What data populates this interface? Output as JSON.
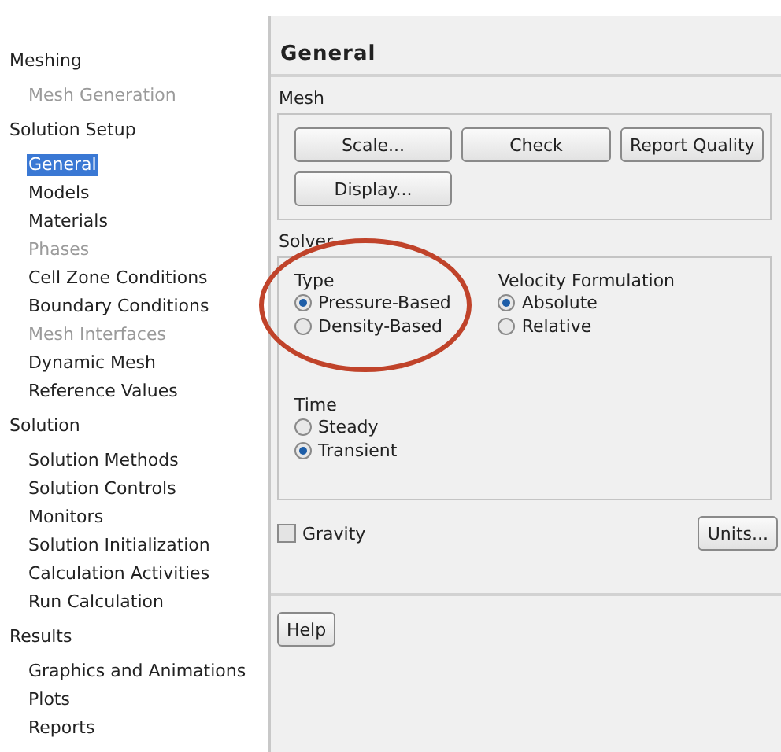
{
  "tree": [
    {
      "label": "Meshing",
      "children": [
        {
          "label": "Mesh Generation",
          "selected": false,
          "disabled": true
        }
      ]
    },
    {
      "label": "Solution Setup",
      "children": [
        {
          "label": "General",
          "selected": true,
          "disabled": false
        },
        {
          "label": "Models",
          "selected": false,
          "disabled": false
        },
        {
          "label": "Materials",
          "selected": false,
          "disabled": false
        },
        {
          "label": "Phases",
          "selected": false,
          "disabled": true
        },
        {
          "label": "Cell Zone Conditions",
          "selected": false,
          "disabled": false
        },
        {
          "label": "Boundary Conditions",
          "selected": false,
          "disabled": false
        },
        {
          "label": "Mesh Interfaces",
          "selected": false,
          "disabled": true
        },
        {
          "label": "Dynamic Mesh",
          "selected": false,
          "disabled": false
        },
        {
          "label": "Reference Values",
          "selected": false,
          "disabled": false
        }
      ]
    },
    {
      "label": "Solution",
      "children": [
        {
          "label": "Solution Methods",
          "selected": false,
          "disabled": false
        },
        {
          "label": "Solution Controls",
          "selected": false,
          "disabled": false
        },
        {
          "label": "Monitors",
          "selected": false,
          "disabled": false
        },
        {
          "label": "Solution Initialization",
          "selected": false,
          "disabled": false
        },
        {
          "label": "Calculation Activities",
          "selected": false,
          "disabled": false
        },
        {
          "label": "Run Calculation",
          "selected": false,
          "disabled": false
        }
      ]
    },
    {
      "label": "Results",
      "children": [
        {
          "label": "Graphics and Animations",
          "selected": false,
          "disabled": false
        },
        {
          "label": "Plots",
          "selected": false,
          "disabled": false
        },
        {
          "label": "Reports",
          "selected": false,
          "disabled": false
        }
      ]
    }
  ],
  "panel": {
    "title": "General",
    "mesh": {
      "label": "Mesh",
      "buttons": [
        "Scale...",
        "Check",
        "Report Quality",
        "Display..."
      ]
    },
    "solver": {
      "label": "Solver",
      "type": {
        "label": "Type",
        "options": [
          {
            "label": "Pressure-Based",
            "selected": true
          },
          {
            "label": "Density-Based",
            "selected": false
          }
        ]
      },
      "velocity": {
        "label": "Velocity Formulation",
        "options": [
          {
            "label": "Absolute",
            "selected": true
          },
          {
            "label": "Relative",
            "selected": false
          }
        ]
      },
      "time": {
        "label": "Time",
        "options": [
          {
            "label": "Steady",
            "selected": false
          },
          {
            "label": "Transient",
            "selected": true
          }
        ]
      }
    },
    "gravity": {
      "label": "Gravity",
      "checked": false
    },
    "units_button": "Units...",
    "help_button": "Help",
    "annotations": [
      {
        "kind": "ellipse"
      }
    ]
  }
}
